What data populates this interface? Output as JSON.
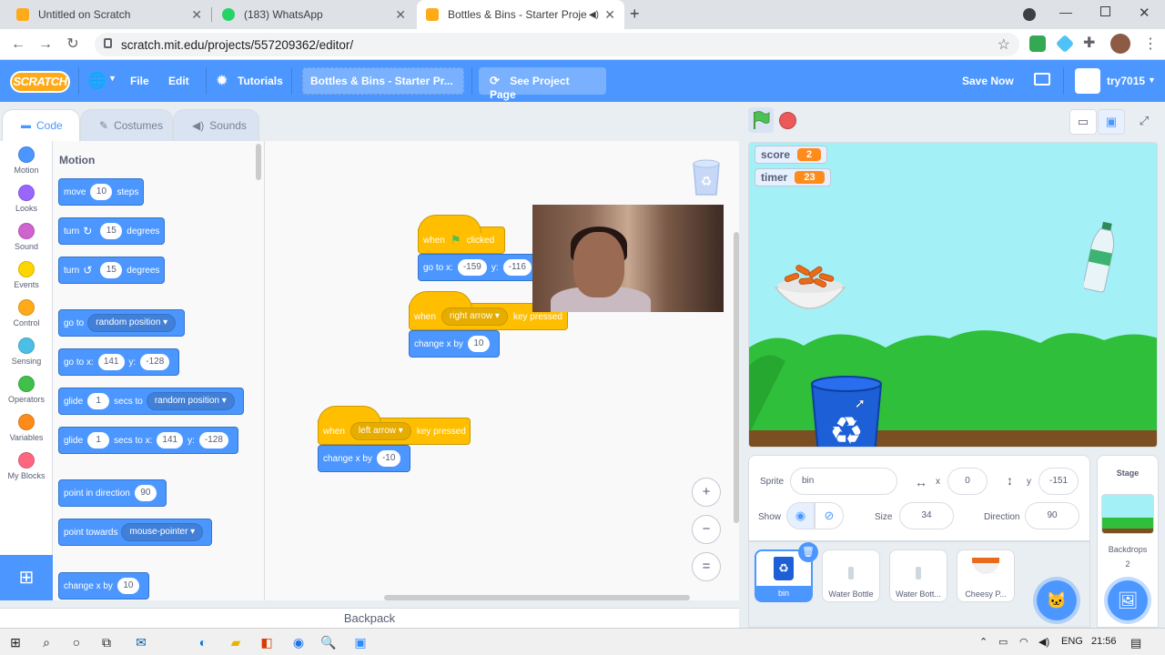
{
  "browser": {
    "tabs": [
      {
        "title": "Untitled on Scratch",
        "active": false
      },
      {
        "title": "(183) WhatsApp",
        "active": false
      },
      {
        "title": "Bottles & Bins - Starter Proje",
        "active": true
      }
    ],
    "url": "scratch.mit.edu/projects/557209362/editor/"
  },
  "menubar": {
    "logo": "SCRATCH",
    "file": "File",
    "edit": "Edit",
    "tutorials": "Tutorials",
    "project_title": "Bottles & Bins - Starter Pr...",
    "see_project": "See Project Page",
    "save_now": "Save Now",
    "username": "try7015"
  },
  "editor_tabs": {
    "code": "Code",
    "costumes": "Costumes",
    "sounds": "Sounds"
  },
  "categories": [
    {
      "label": "Motion",
      "color": "#4c97ff"
    },
    {
      "label": "Looks",
      "color": "#9966ff"
    },
    {
      "label": "Sound",
      "color": "#cf63cf"
    },
    {
      "label": "Events",
      "color": "#ffd500"
    },
    {
      "label": "Control",
      "color": "#ffab19"
    },
    {
      "label": "Sensing",
      "color": "#4cbfe6"
    },
    {
      "label": "Operators",
      "color": "#40bf4a"
    },
    {
      "label": "Variables",
      "color": "#ff8c1a"
    },
    {
      "label": "My Blocks",
      "color": "#ff6680"
    }
  ],
  "flyout": {
    "heading": "Motion",
    "move": {
      "a": "move",
      "v": "10",
      "b": "steps"
    },
    "turn_right": {
      "a": "turn",
      "v": "15",
      "b": "degrees"
    },
    "turn_left": {
      "a": "turn",
      "v": "15",
      "b": "degrees"
    },
    "goto_random": {
      "a": "go to",
      "dd": "random position"
    },
    "goto_xy": {
      "a": "go to x:",
      "x": "141",
      "yl": "y:",
      "y": "-128"
    },
    "glide_random": {
      "a": "glide",
      "v": "1",
      "b": "secs to",
      "dd": "random position"
    },
    "glide_xy": {
      "a": "glide",
      "v": "1",
      "b": "secs to x:",
      "x": "141",
      "yl": "y:",
      "y": "-128"
    },
    "point_dir": {
      "a": "point in direction",
      "v": "90"
    },
    "point_towards": {
      "a": "point towards",
      "dd": "mouse-pointer"
    },
    "change_x": {
      "a": "change x by",
      "v": "10"
    }
  },
  "scripts": {
    "s1": {
      "when": "when",
      "clicked": "clicked",
      "goto": "go to x:",
      "x": "-159",
      "yl": "y:",
      "y": "-116"
    },
    "s2": {
      "when": "when",
      "key": "right arrow",
      "pressed": "key pressed",
      "change": "change x by",
      "v": "10"
    },
    "s3": {
      "when": "when",
      "key": "left arrow",
      "pressed": "key pressed",
      "change": "change x by",
      "v": "-10"
    }
  },
  "zoom": {
    "in": "+",
    "out": "−",
    "reset": "="
  },
  "backpack": "Backpack",
  "stage": {
    "monitors": [
      {
        "label": "score",
        "value": "2"
      },
      {
        "label": "timer",
        "value": "23"
      }
    ]
  },
  "sprite_info": {
    "sprite_label": "Sprite",
    "sprite_name": "bin",
    "x_label": "x",
    "x": "0",
    "y_label": "y",
    "y": "-151",
    "show_label": "Show",
    "size_label": "Size",
    "size": "34",
    "direction_label": "Direction",
    "direction": "90"
  },
  "sprites": [
    {
      "name": "bin",
      "selected": true
    },
    {
      "name": "Water Bottle",
      "selected": false
    },
    {
      "name": "Water Bott...",
      "selected": false
    },
    {
      "name": "Cheesy P...",
      "selected": false
    }
  ],
  "stage_panel": {
    "title": "Stage",
    "backdrops_label": "Backdrops",
    "backdrops_count": "2"
  },
  "taskbar": {
    "lang": "ENG",
    "time": "21:56"
  }
}
